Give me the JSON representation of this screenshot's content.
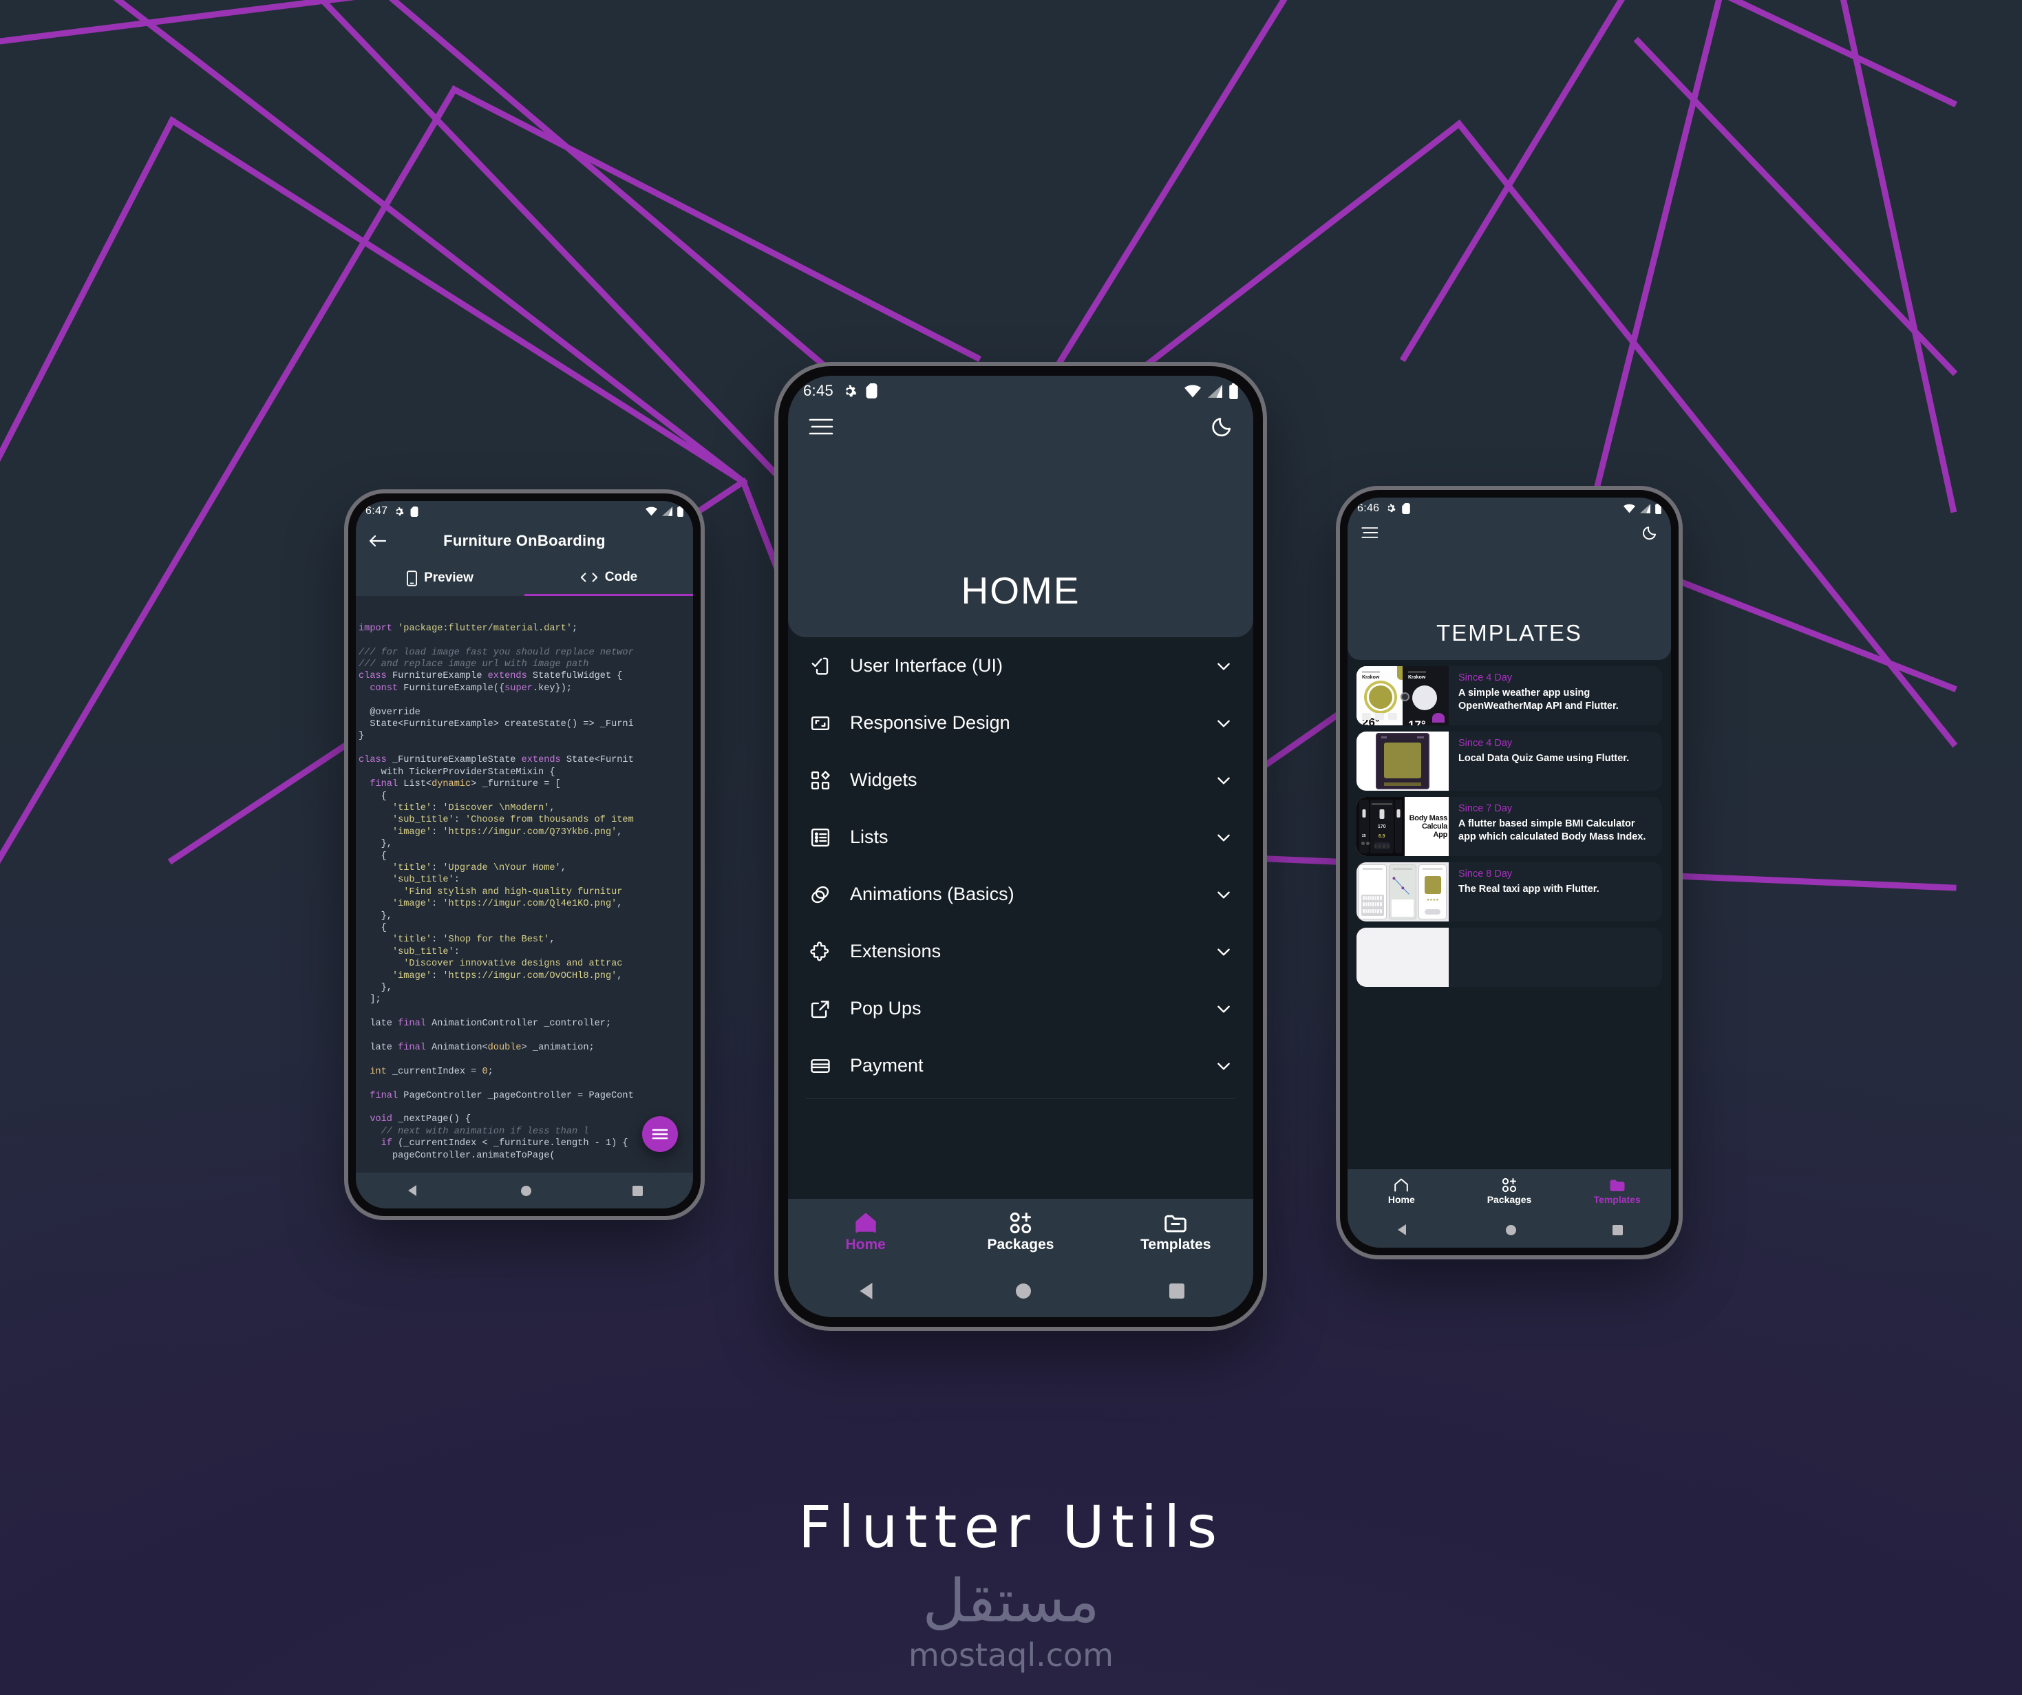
{
  "theme": {
    "bg_top": "#232e38",
    "bg_bottom": "#232340",
    "line_color": "#9b34b4",
    "accent": "#a832c0",
    "surface": "#2b3742",
    "screen_bg": "#151d25",
    "code_bg": "#222a35"
  },
  "brand": {
    "title": "Flutter Utils",
    "logo_arabic": "مستقل",
    "domain": "mostaql.com"
  },
  "phone_left": {
    "status": {
      "time": "6:47",
      "icons": [
        "gear-icon",
        "sd-card-icon",
        "wifi-icon",
        "signal-icon",
        "battery-icon"
      ]
    },
    "header": {
      "back_icon": "back-arrow-icon",
      "title": "Furniture OnBoarding"
    },
    "tabs": [
      {
        "label": "Preview",
        "icon": "mobile-icon",
        "active": false
      },
      {
        "label": "Code",
        "icon": "code-brackets-icon",
        "active": true
      }
    ],
    "fab": {
      "icon": "menu-lines-icon"
    },
    "code_lines": [
      [
        [
          "kw",
          "import"
        ],
        [
          "txt",
          " "
        ],
        [
          "str",
          "'package:flutter/material.dart'"
        ],
        [
          "txt",
          ";"
        ]
      ],
      [
        [
          "txt",
          ""
        ]
      ],
      [
        [
          "cmt",
          "/// for load image fast you should replace networ"
        ]
      ],
      [
        [
          "cmt",
          "/// and replace image url with image path"
        ]
      ],
      [
        [
          "kw",
          "class"
        ],
        [
          "txt",
          " FurnitureExample "
        ],
        [
          "kw",
          "extends"
        ],
        [
          "txt",
          " StatefulWidget {"
        ]
      ],
      [
        [
          "txt",
          "  "
        ],
        [
          "kw",
          "const"
        ],
        [
          "txt",
          " FurnitureExample({"
        ],
        [
          "kw",
          "super"
        ],
        [
          "txt",
          ".key});"
        ]
      ],
      [
        [
          "txt",
          ""
        ]
      ],
      [
        [
          "txt",
          "  @override"
        ]
      ],
      [
        [
          "txt",
          "  State<FurnitureExample> createState() => _Furni"
        ]
      ],
      [
        [
          "txt",
          "}"
        ]
      ],
      [
        [
          "txt",
          ""
        ]
      ],
      [
        [
          "kw",
          "class"
        ],
        [
          "txt",
          " _FurnitureExampleState "
        ],
        [
          "kw",
          "extends"
        ],
        [
          "txt",
          " State<Furnit"
        ]
      ],
      [
        [
          "txt",
          "    with TickerProviderStateMixin {"
        ]
      ],
      [
        [
          "txt",
          "  "
        ],
        [
          "kw",
          "final"
        ],
        [
          "txt",
          " List<"
        ],
        [
          "type",
          "dynamic"
        ],
        [
          "txt",
          "> _furniture = ["
        ]
      ],
      [
        [
          "txt",
          "    {"
        ]
      ],
      [
        [
          "txt",
          "      "
        ],
        [
          "str",
          "'title'"
        ],
        [
          "txt",
          ": "
        ],
        [
          "str",
          "'Discover \\nModern'"
        ],
        [
          "txt",
          ","
        ]
      ],
      [
        [
          "txt",
          "      "
        ],
        [
          "str",
          "'sub_title'"
        ],
        [
          "txt",
          ": "
        ],
        [
          "str",
          "'Choose from thousands of item"
        ]
      ],
      [
        [
          "txt",
          "      "
        ],
        [
          "str",
          "'image'"
        ],
        [
          "txt",
          ": "
        ],
        [
          "str",
          "'https://imgur.com/Q73Ykb6.png'"
        ],
        [
          "txt",
          ","
        ]
      ],
      [
        [
          "txt",
          "    },"
        ]
      ],
      [
        [
          "txt",
          "    {"
        ]
      ],
      [
        [
          "txt",
          "      "
        ],
        [
          "str",
          "'title'"
        ],
        [
          "txt",
          ": "
        ],
        [
          "str",
          "'Upgrade \\nYour Home'"
        ],
        [
          "txt",
          ","
        ]
      ],
      [
        [
          "txt",
          "      "
        ],
        [
          "str",
          "'sub_title'"
        ],
        [
          "txt",
          ":"
        ]
      ],
      [
        [
          "txt",
          "        "
        ],
        [
          "str",
          "'Find stylish and high-quality furnitur"
        ]
      ],
      [
        [
          "txt",
          "      "
        ],
        [
          "str",
          "'image'"
        ],
        [
          "txt",
          ": "
        ],
        [
          "str",
          "'https://imgur.com/Ql4e1KO.png'"
        ],
        [
          "txt",
          ","
        ]
      ],
      [
        [
          "txt",
          "    },"
        ]
      ],
      [
        [
          "txt",
          "    {"
        ]
      ],
      [
        [
          "txt",
          "      "
        ],
        [
          "str",
          "'title'"
        ],
        [
          "txt",
          ": "
        ],
        [
          "str",
          "'Shop for the Best'"
        ],
        [
          "txt",
          ","
        ]
      ],
      [
        [
          "txt",
          "      "
        ],
        [
          "str",
          "'sub_title'"
        ],
        [
          "txt",
          ":"
        ]
      ],
      [
        [
          "txt",
          "        "
        ],
        [
          "str",
          "'Discover innovative designs and attrac"
        ]
      ],
      [
        [
          "txt",
          "      "
        ],
        [
          "str",
          "'image'"
        ],
        [
          "txt",
          ": "
        ],
        [
          "str",
          "'https://imgur.com/OvOCHl8.png'"
        ],
        [
          "txt",
          ","
        ]
      ],
      [
        [
          "txt",
          "    },"
        ]
      ],
      [
        [
          "txt",
          "  ];"
        ]
      ],
      [
        [
          "txt",
          ""
        ]
      ],
      [
        [
          "txt",
          "  late "
        ],
        [
          "kw",
          "final"
        ],
        [
          "txt",
          " AnimationController _controller;"
        ]
      ],
      [
        [
          "txt",
          ""
        ]
      ],
      [
        [
          "txt",
          "  late "
        ],
        [
          "kw",
          "final"
        ],
        [
          "txt",
          " Animation<"
        ],
        [
          "type",
          "double"
        ],
        [
          "txt",
          "> _animation;"
        ]
      ],
      [
        [
          "txt",
          ""
        ]
      ],
      [
        [
          "txt",
          "  "
        ],
        [
          "num",
          "int"
        ],
        [
          "txt",
          " _currentIndex = "
        ],
        [
          "num",
          "0"
        ],
        [
          "txt",
          ";"
        ]
      ],
      [
        [
          "txt",
          ""
        ]
      ],
      [
        [
          "txt",
          "  "
        ],
        [
          "kw",
          "final"
        ],
        [
          "txt",
          " PageController _pageController = PageCont"
        ]
      ],
      [
        [
          "txt",
          ""
        ]
      ],
      [
        [
          "txt",
          "  "
        ],
        [
          "kw",
          "void"
        ],
        [
          "txt",
          " _nextPage() {"
        ]
      ],
      [
        [
          "txt",
          "    "
        ],
        [
          "cmt",
          "// next with animation if less than l"
        ]
      ],
      [
        [
          "txt",
          "    "
        ],
        [
          "kw",
          "if"
        ],
        [
          "txt",
          " (_currentIndex < _furniture.length - 1) {"
        ]
      ],
      [
        [
          "txt",
          "      pageController.animateToPage("
        ]
      ]
    ]
  },
  "phone_center": {
    "status": {
      "time": "6:45"
    },
    "header": {
      "menu_icon": "hamburger-icon",
      "theme_icon": "moon-icon",
      "title": "HOME"
    },
    "menu_items": [
      {
        "label": "User Interface (UI)",
        "icon": "ui-phone-check-icon"
      },
      {
        "label": "Responsive Design",
        "icon": "resize-frame-icon"
      },
      {
        "label": "Widgets",
        "icon": "widgets-grid-icon"
      },
      {
        "label": "Lists",
        "icon": "list-icon"
      },
      {
        "label": "Animations (Basics)",
        "icon": "animation-layers-icon"
      },
      {
        "label": "Extensions",
        "icon": "puzzle-piece-icon"
      },
      {
        "label": "Pop Ups",
        "icon": "external-link-icon"
      },
      {
        "label": "Payment",
        "icon": "credit-card-icon"
      }
    ],
    "bottom_nav": [
      {
        "label": "Home",
        "icon": "home-icon",
        "active": true
      },
      {
        "label": "Packages",
        "icon": "packages-icon",
        "active": false
      },
      {
        "label": "Templates",
        "icon": "folder-icon",
        "active": false
      }
    ]
  },
  "phone_right": {
    "status": {
      "time": "6:46"
    },
    "header": {
      "menu_icon": "hamburger-icon",
      "theme_icon": "moon-icon",
      "title": "TEMPLATES"
    },
    "templates": [
      {
        "since": "Since 4 Day",
        "description": "A simple weather app using OpenWeatherMap API and Flutter.",
        "thumb": "weather-app-thumb"
      },
      {
        "since": "Since 4 Day",
        "description": "Local Data Quiz Game using Flutter.",
        "thumb": "quiz-game-thumb"
      },
      {
        "since": "Since 7 Day",
        "description": "A flutter based simple BMI Calculator app which calculated Body Mass Index.",
        "thumb": "bmi-calculator-thumb"
      },
      {
        "since": "Since 8 Day",
        "description": "The Real taxi app with Flutter.",
        "thumb": "taxi-app-thumb"
      }
    ],
    "bottom_nav": [
      {
        "label": "Home",
        "icon": "home-icon",
        "active": false
      },
      {
        "label": "Packages",
        "icon": "packages-icon",
        "active": false
      },
      {
        "label": "Templates",
        "icon": "folder-icon",
        "active": true
      }
    ]
  }
}
